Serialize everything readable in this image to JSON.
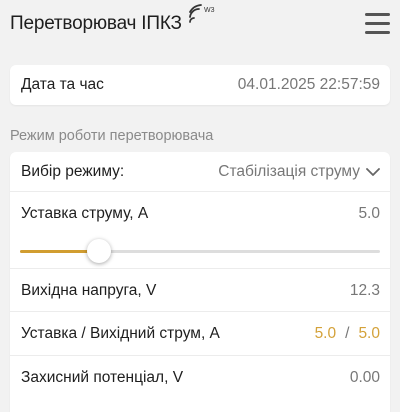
{
  "header": {
    "title": "Перетворювач ІПКЗ",
    "signal_badge": "W3",
    "signal_icon": "wifi-signal-icon",
    "menu_icon": "hamburger-menu-icon"
  },
  "datetime": {
    "label": "Дата та час",
    "value": "04.01.2025 22:57:59"
  },
  "section": {
    "label": "Режим роботи перетворювача"
  },
  "mode": {
    "label": "Вибір режиму:",
    "value": "Стабілізація струму"
  },
  "setpoint": {
    "label": "Уставка струму, А",
    "value": "5.0",
    "slider_fraction": 0.22
  },
  "voltage": {
    "label": "Вихідна напруга, V",
    "value": "12.3"
  },
  "current": {
    "label": "Уставка / Вихідний струм, А",
    "setpoint": "5.0",
    "separator": "/",
    "output": "5.0"
  },
  "potential": {
    "label": "Захисний потенціал, V",
    "value": "0.00"
  },
  "colors": {
    "accent": "#d4a23a",
    "background": "#f2f2f2",
    "card": "#ffffff",
    "muted_text": "#777777"
  }
}
